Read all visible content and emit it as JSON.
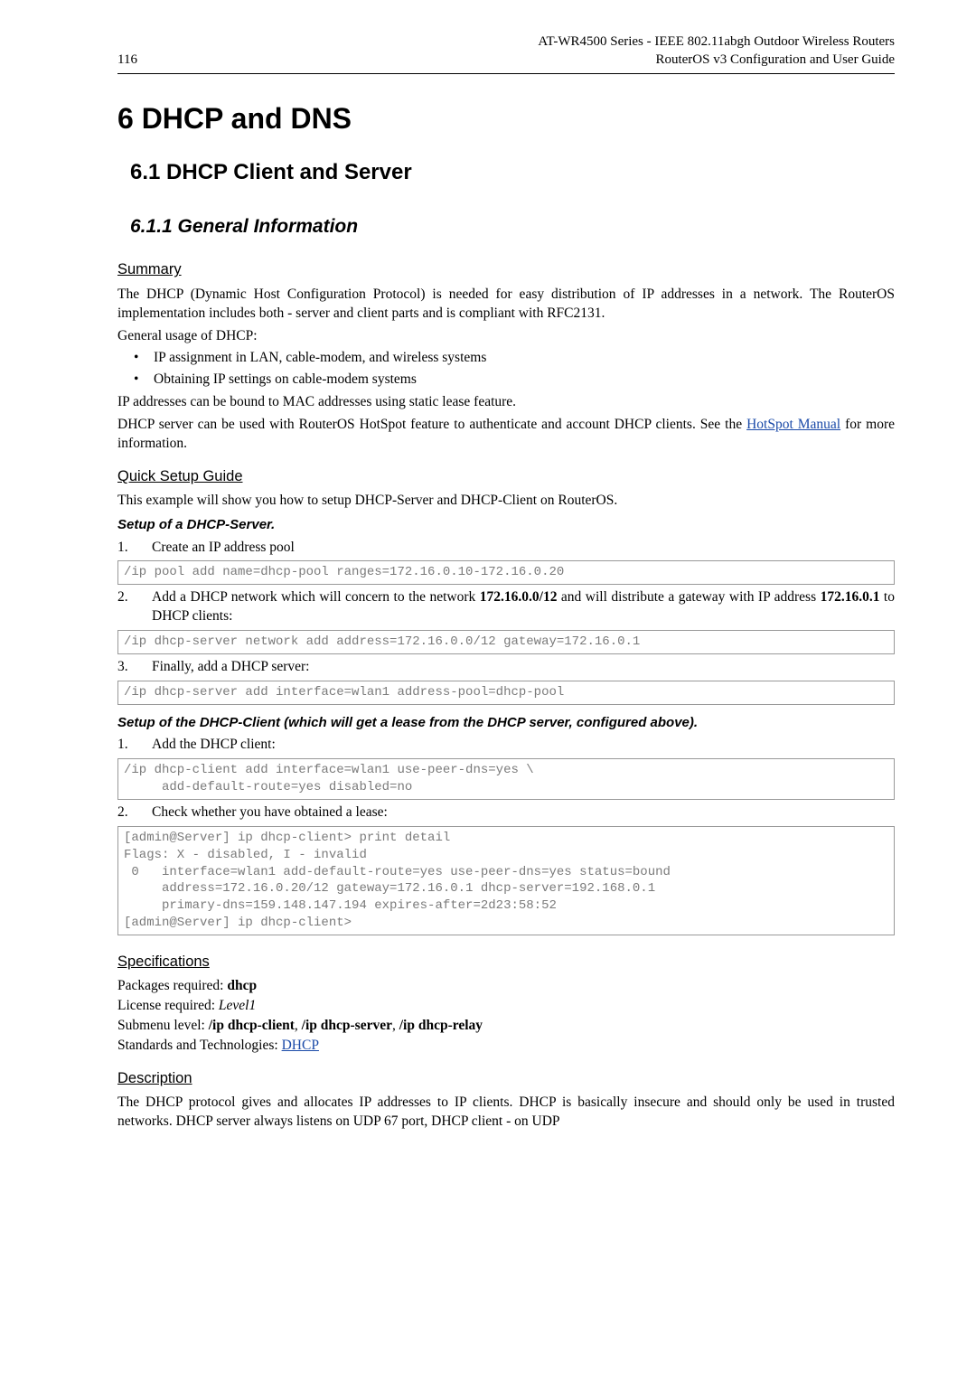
{
  "header": {
    "page_number": "116",
    "title_line1": "AT-WR4500 Series - IEEE 802.11abgh Outdoor Wireless Routers",
    "title_line2": "RouterOS v3 Configuration and User Guide"
  },
  "h1": "6  DHCP and DNS",
  "h2": "6.1 DHCP Client and Server",
  "section_611": "6.1.1 General Information",
  "summary": {
    "heading": "Summary",
    "para1": "The DHCP (Dynamic Host Configuration Protocol) is needed for easy distribution of IP addresses in a network. The RouterOS implementation includes both - server and client parts and is compliant with RFC2131.",
    "para_usage": "General usage of DHCP:",
    "bullets": [
      "IP assignment in LAN, cable-modem, and wireless systems",
      "Obtaining IP settings on cable-modem systems"
    ],
    "para2": "IP addresses can be bound to MAC addresses using static lease feature.",
    "para3a": "DHCP server can be used with RouterOS HotSpot feature to authenticate and account DHCP clients. See the ",
    "link1": "HotSpot Manual",
    "para3b": " for more information."
  },
  "quick": {
    "heading": "Quick Setup Guide",
    "intro": "This example will show you how to setup DHCP-Server and DHCP-Client on  RouterOS.",
    "server_title": "Setup of a DHCP-Server.",
    "steps": [
      {
        "num": "1.",
        "text": "Create an IP address pool"
      },
      {
        "num": "2.",
        "lead": "Add a DHCP network which will concern to the network ",
        "bold1": "172.16.0.0/12",
        "mid": " and will distribute a gateway with IP address ",
        "bold2": "172.16.0.1",
        "tail": " to DHCP clients:"
      },
      {
        "num": "3.",
        "text": "Finally, add a DHCP server:"
      }
    ],
    "code1": "/ip pool add name=dhcp-pool ranges=172.16.0.10-172.16.0.20",
    "code2": "/ip dhcp-server network add address=172.16.0.0/12 gateway=172.16.0.1",
    "code3": "/ip dhcp-server add interface=wlan1 address-pool=dhcp-pool",
    "client_title": "Setup of the DHCP-Client (which will get a lease from the DHCP server, configured above).",
    "client_steps": [
      {
        "num": "1.",
        "text": "Add the DHCP client:"
      },
      {
        "num": "2.",
        "text": "Check whether you have obtained a lease:"
      }
    ],
    "client_code1": "/ip dhcp-client add interface=wlan1 use-peer-dns=yes \\\n     add-default-route=yes disabled=no",
    "client_code2": "[admin@Server] ip dhcp-client> print detail\nFlags: X - disabled, I - invalid\n 0   interface=wlan1 add-default-route=yes use-peer-dns=yes status=bound\n     address=172.16.0.20/12 gateway=172.16.0.1 dhcp-server=192.168.0.1\n     primary-dns=159.148.147.194 expires-after=2d23:58:52\n[admin@Server] ip dhcp-client>"
  },
  "specs": {
    "heading": "Specifications",
    "l1a": "Packages required: ",
    "l1b": "dhcp",
    "l2a": "License required: ",
    "l2b": "Level1",
    "l3a": "Submenu level: ",
    "l3b": "/ip dhcp-client",
    "l3c": ", ",
    "l3d": "/ip dhcp-server",
    "l3e": ", ",
    "l3f": "/ip dhcp-relay",
    "l4a": "Standards and Technologies: ",
    "l4b": "DHCP"
  },
  "desc": {
    "heading": "Description",
    "para": "The DHCP protocol gives and allocates IP addresses to IP clients. DHCP is basically insecure and should only be used in trusted networks. DHCP server always listens on UDP 67 port, DHCP client - on UDP"
  }
}
